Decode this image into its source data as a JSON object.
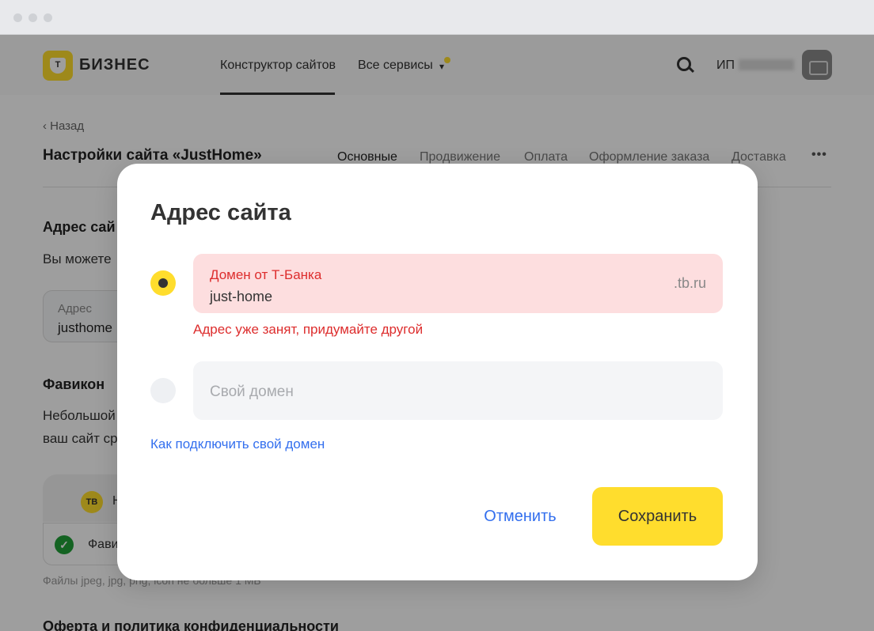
{
  "header": {
    "logo_letter": "Т",
    "logo_text": "БИЗНЕС",
    "nav": [
      "Конструктор сайтов",
      "Все сервисы"
    ],
    "account_prefix": "ИП"
  },
  "page": {
    "back_label": "Назад",
    "title": "Настройки сайта «JustHome»",
    "tabs": [
      "Основные",
      "Продвижение",
      "Оплата",
      "Оформление заказа",
      "Доставка"
    ],
    "more_label": "•••",
    "address_section": {
      "title": "Адрес сай",
      "text": "Вы можете",
      "field_label": "Адрес",
      "field_value": "justhome"
    },
    "favicon_section": {
      "title": "Фавикон",
      "text_line1": "Небольшой",
      "text_line2": "ваш сайт ср",
      "badge": "ТВ",
      "tab_text": "Н",
      "row_text": "Фави",
      "hint": "Файлы jpeg, jpg, png, icon не больше 1 МБ"
    },
    "bottom_section_title": "Оферта и политика конфиденциальности"
  },
  "modal": {
    "title": "Адрес сайта",
    "bank_domain": {
      "label": "Домен от Т-Банка",
      "value": "just-home",
      "suffix": ".tb.ru",
      "error": "Адрес уже занят, придумайте другой",
      "selected": true
    },
    "own_domain": {
      "placeholder": "Свой домен",
      "selected": false
    },
    "help_link": "Как подключить свой домен",
    "cancel_label": "Отменить",
    "save_label": "Сохранить"
  },
  "colors": {
    "accent_yellow": "#ffdd2d",
    "error_red": "#dd2d2d",
    "error_bg": "#fddedf",
    "link_blue": "#336fee"
  }
}
